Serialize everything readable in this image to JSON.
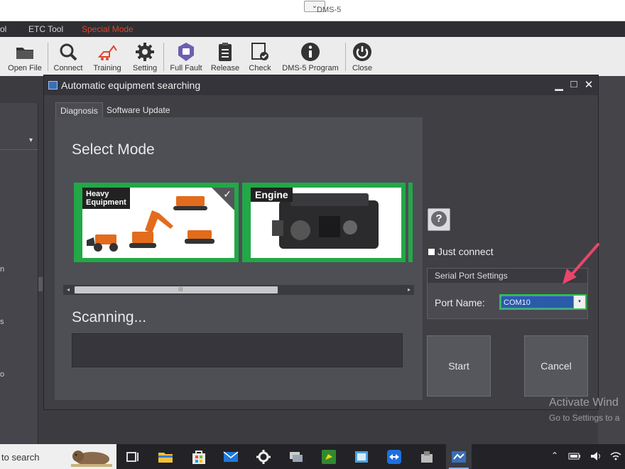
{
  "window": {
    "title": "DMS-5",
    "collapse_glyph": "⌄"
  },
  "menu": [
    {
      "label": "ol",
      "special": false
    },
    {
      "label": "ETC Tool",
      "special": false
    },
    {
      "label": "Special Mode",
      "special": true
    }
  ],
  "toolbar": {
    "open_file": {
      "label": "Open File",
      "icon": "folder-icon"
    },
    "connect": {
      "label": "Connect",
      "icon": "search-icon"
    },
    "training": {
      "label": "Training",
      "icon": "excavator-icon"
    },
    "setting": {
      "label": "Setting",
      "icon": "gear-icon"
    },
    "full_fault": {
      "label": "Full Fault",
      "icon": "shield-icon"
    },
    "release": {
      "label": "Release",
      "icon": "clipboard-icon"
    },
    "check": {
      "label": "Check",
      "icon": "check-document-icon"
    },
    "program": {
      "label": "DMS-5 Program",
      "icon": "info-icon"
    },
    "close": {
      "label": "Close",
      "icon": "power-icon"
    }
  },
  "left_panel": {
    "fragments": [
      "n",
      "s",
      "o"
    ],
    "dropdown_glyph": "▾"
  },
  "dialog": {
    "title": "Automatic equipment searching",
    "controls": {
      "minimize": "▁",
      "maximize": "□",
      "close": "✕"
    },
    "tabs": [
      {
        "label": "Diagnosis",
        "active": true
      },
      {
        "label": "Software Update",
        "active": false
      }
    ],
    "select_mode_title": "Select Mode",
    "modes": [
      {
        "label": "Heavy\nEquipment",
        "selected": true,
        "check": "✓"
      },
      {
        "label": "Engine",
        "selected": false
      }
    ],
    "scrollbar": {
      "left": "◂",
      "right": "▸",
      "grip": "III",
      "thumb_fraction": 0.62
    },
    "scanning_text": "Scanning...",
    "help_glyph": "?",
    "just_connect": {
      "label": "Just connect",
      "checked": false
    },
    "serial_port": {
      "header": "Serial Port Settings",
      "port_label": "Port Name:",
      "port_value": "COM10",
      "caret": "▾"
    },
    "start_label": "Start",
    "cancel_label": "Cancel"
  },
  "watermark": {
    "line1": "Activate Wind",
    "line2": "Go to Settings to a"
  },
  "taskbar": {
    "search_text": "to search",
    "tray": {
      "chevron": "⌃"
    }
  },
  "colors": {
    "accent_green": "#22a847",
    "selection_blue": "#2c5aaa",
    "special_red": "#e0442e",
    "arrow_pink": "#e8466a"
  }
}
